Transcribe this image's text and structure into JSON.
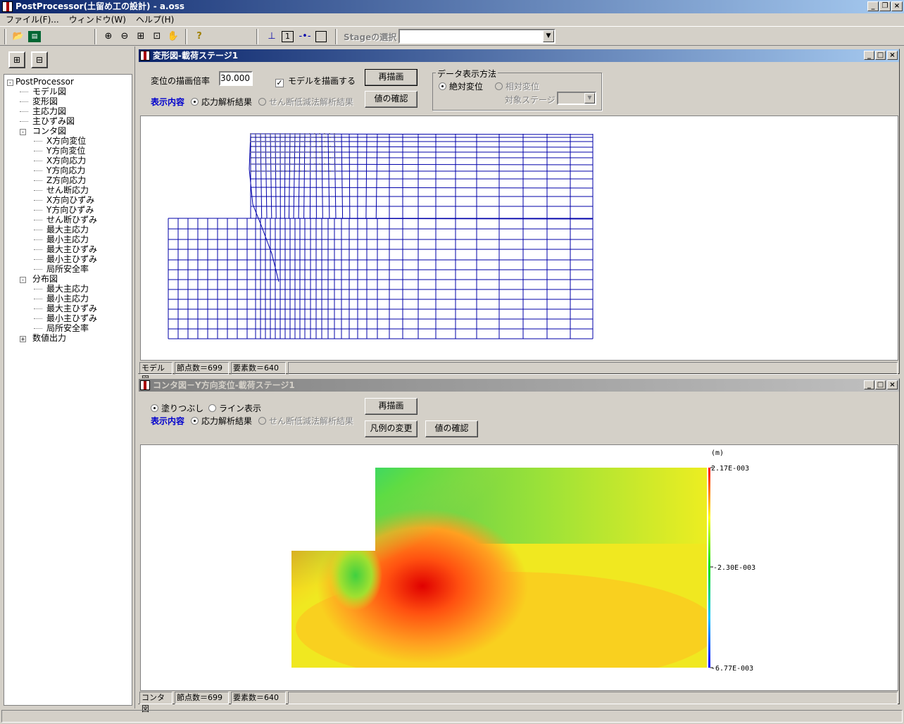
{
  "app": {
    "title": "PostProcessor(土留め工の設計) - a.oss"
  },
  "menu": [
    "ファイル(F)...",
    "ウィンドウ(W)",
    "ヘルプ(H)"
  ],
  "toolbar": {
    "stage_label": "Stageの選択",
    "stage_value": "",
    "page_num": "1"
  },
  "tree": {
    "root": "PostProcessor",
    "items": [
      {
        "label": "モデル図",
        "level": 1
      },
      {
        "label": "変形図",
        "level": 1
      },
      {
        "label": "主応力図",
        "level": 1
      },
      {
        "label": "主ひずみ図",
        "level": 1
      },
      {
        "label": "コンタ図",
        "level": 1,
        "expander": "-"
      },
      {
        "label": "X方向変位",
        "level": 2
      },
      {
        "label": "Y方向変位",
        "level": 2
      },
      {
        "label": "X方向応力",
        "level": 2
      },
      {
        "label": "Y方向応力",
        "level": 2
      },
      {
        "label": "Z方向応力",
        "level": 2
      },
      {
        "label": "せん断応力",
        "level": 2
      },
      {
        "label": "X方向ひずみ",
        "level": 2
      },
      {
        "label": "Y方向ひずみ",
        "level": 2
      },
      {
        "label": "せん断ひずみ",
        "level": 2
      },
      {
        "label": "最大主応力",
        "level": 2
      },
      {
        "label": "最小主応力",
        "level": 2
      },
      {
        "label": "最大主ひずみ",
        "level": 2
      },
      {
        "label": "最小主ひずみ",
        "level": 2
      },
      {
        "label": "局所安全率",
        "level": 2
      },
      {
        "label": "分布図",
        "level": 1,
        "expander": "-"
      },
      {
        "label": "最大主応力",
        "level": 2
      },
      {
        "label": "最小主応力",
        "level": 2
      },
      {
        "label": "最大主ひずみ",
        "level": 2
      },
      {
        "label": "最小主ひずみ",
        "level": 2
      },
      {
        "label": "局所安全率",
        "level": 2
      },
      {
        "label": "数値出力",
        "level": 1,
        "expander": "+"
      }
    ]
  },
  "deform": {
    "title": "変形図-載荷ステージ1",
    "scale_label": "変位の描画倍率",
    "scale_value": "30.000",
    "draw_model_label": "モデルを描画する",
    "redraw": "再描画",
    "check_value": "値の確認",
    "display_label": "表示内容",
    "opt_stress": "応力解析結果",
    "opt_shear": "せん断低減法解析結果",
    "group_title": "データ表示方法",
    "opt_abs": "絶対変位",
    "opt_rel": "相対変位",
    "target_stage": "対象ステージ",
    "status": [
      "モデル図",
      "節点数＝699",
      "要素数＝640"
    ]
  },
  "contour": {
    "title": "コンタ図－Y方向変位-載荷ステージ1",
    "opt_fill": "塗りつぶし",
    "opt_line": "ライン表示",
    "redraw": "再描画",
    "legend_change": "凡例の変更",
    "check_value": "値の確認",
    "display_label": "表示内容",
    "opt_stress": "応力解析結果",
    "opt_shear": "せん断低減法解析結果",
    "unit": "(m)",
    "legend": [
      "2.17E-003",
      "-2.30E-003",
      "-6.77E-003"
    ],
    "status": [
      "コンタ図",
      "節点数＝699",
      "要素数＝640"
    ]
  }
}
